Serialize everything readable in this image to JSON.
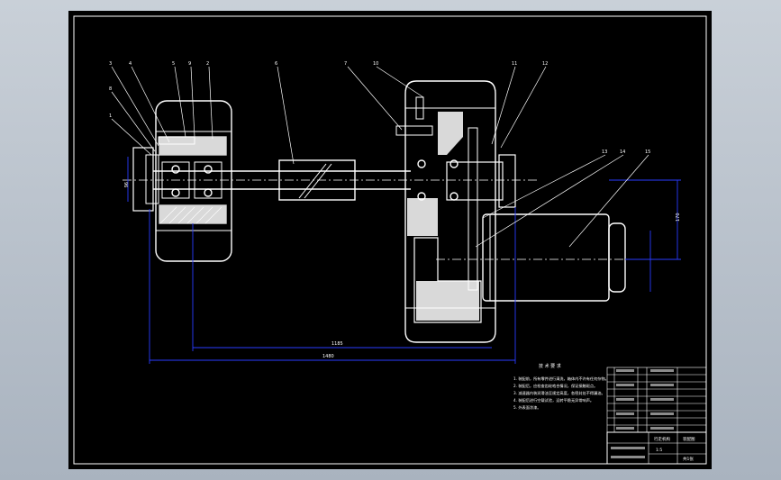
{
  "viewport": {
    "background": "#000000",
    "line_color": "#ffffff",
    "dim_color": "#2a3cff",
    "leader_color": "#ffffff"
  },
  "balloons": [
    "3",
    "4",
    "5",
    "1",
    "8",
    "9",
    "2",
    "6",
    "7",
    "10",
    "11",
    "12",
    "13",
    "14",
    "15"
  ],
  "dimensions": {
    "overall_length": "1480",
    "pitch_length": "1185",
    "height": "170",
    "end_width": "96"
  },
  "notes": {
    "title": "技 术 要 求",
    "lines": [
      "1. 装配前，所有零件进行清洗，箱体内不许有任何杂物。",
      "2. 装配后，应检查齿轮啮合情况，保证接触斑点。",
      "3. 减速器内装润滑油至规定高度，各密封处不得漏油。",
      "4. 装配后进行空载试验，运转平稳无异常响声。",
      "5. 外表面涂漆。"
    ]
  },
  "title_block": {
    "drawing_name": "行走机构",
    "drawing_no": "装配图",
    "scale": "1:5",
    "sheet": "共1张"
  }
}
